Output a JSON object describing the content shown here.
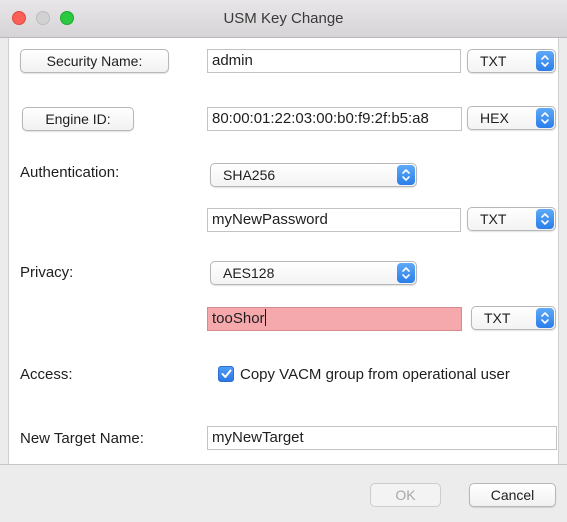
{
  "window": {
    "title": "USM Key Change"
  },
  "security": {
    "button_label": "Security Name:",
    "value": "admin",
    "format": "TXT"
  },
  "engine": {
    "button_label": "Engine ID:",
    "value": "80:00:01:22:03:00:b0:f9:2f:b5:a8",
    "format": "HEX"
  },
  "authentication": {
    "label": "Authentication:",
    "protocol": "SHA256",
    "password": "myNewPassword",
    "format": "TXT"
  },
  "privacy": {
    "label": "Privacy:",
    "protocol": "AES128",
    "password": "tooShor",
    "format": "TXT"
  },
  "access": {
    "label": "Access:",
    "checkbox_label": "Copy VACM group from operational user",
    "checked": true
  },
  "target": {
    "label": "New Target Name:",
    "value": "myNewTarget"
  },
  "footer": {
    "ok_label": "OK",
    "cancel_label": "Cancel"
  },
  "colors": {
    "error_field": "#f6a9ad",
    "accent": "#2b78e4"
  }
}
